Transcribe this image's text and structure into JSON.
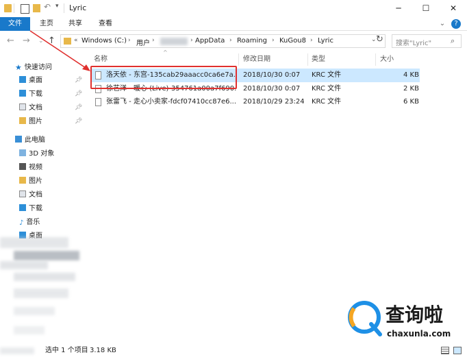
{
  "window": {
    "title": "Lyric",
    "controls": {
      "minimize": "─",
      "maximize": "☐",
      "close": "✕"
    }
  },
  "ribbon": {
    "tabs": [
      "文件",
      "主页",
      "共享",
      "查看"
    ],
    "help_icon": "?"
  },
  "address": {
    "segments": [
      "Windows (C:)",
      "用户",
      "AppData",
      "Roaming",
      "KuGou8",
      "Lyric"
    ],
    "search_placeholder": "搜索\"Lyric\""
  },
  "nav_pane": {
    "quick_access": "快速访问",
    "quick_items": [
      {
        "label": "桌面",
        "icon": "desktop-icon"
      },
      {
        "label": "下载",
        "icon": "download-icon"
      },
      {
        "label": "文档",
        "icon": "documents-icon"
      },
      {
        "label": "图片",
        "icon": "pictures-icon"
      }
    ],
    "this_pc": "此电脑",
    "pc_items": [
      {
        "label": "3D 对象",
        "icon": "3d-objects-icon"
      },
      {
        "label": "视频",
        "icon": "videos-icon"
      },
      {
        "label": "图片",
        "icon": "pictures-icon"
      },
      {
        "label": "文档",
        "icon": "documents-icon"
      },
      {
        "label": "下载",
        "icon": "download-icon"
      },
      {
        "label": "音乐",
        "icon": "music-icon"
      },
      {
        "label": "桌面",
        "icon": "desktop-icon"
      }
    ]
  },
  "columns": {
    "name": "名称",
    "date": "修改日期",
    "type": "类型",
    "size": "大小"
  },
  "files": [
    {
      "name": "洛天依 - 东宫-135cab29aaacc0ca6e7a...",
      "date": "2018/10/30 0:07",
      "type": "KRC 文件",
      "size": "4 KB",
      "selected": true
    },
    {
      "name": "徐艺洋 - 暖心 (Live)-354761a00a7f690...",
      "date": "2018/10/30 0:07",
      "type": "KRC 文件",
      "size": "2 KB",
      "selected": false
    },
    {
      "name": "张雷飞 - 走心小卖家-fdcf07410cc87e6...",
      "date": "2018/10/29 23:24",
      "type": "KRC 文件",
      "size": "6 KB",
      "selected": false
    }
  ],
  "status": {
    "selection": "选中 1 个项目",
    "size": "3.18 KB"
  },
  "watermark": {
    "brand": "查询啦",
    "domain": "chaxunla.com"
  },
  "colors": {
    "accent": "#1979ca",
    "selection": "#cce8ff",
    "highlight": "#e0302e",
    "arrow": "#e0302e"
  }
}
